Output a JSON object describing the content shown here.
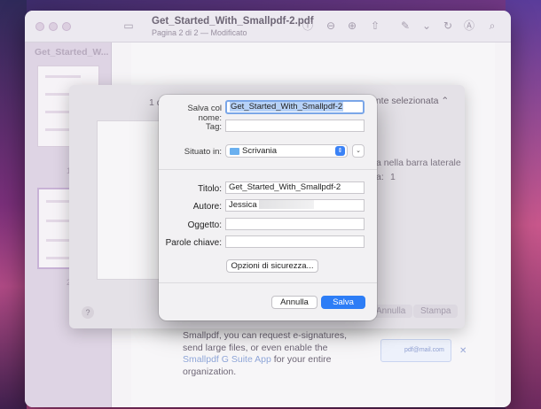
{
  "window": {
    "doc_title": "Get_Started_With_Smallpdf-2.pdf",
    "doc_subtitle": "Pagina 2 di 2 — Modificato",
    "sidebar_title": "Get_Started_W...",
    "page_number_1": "1",
    "page_number_2": "2"
  },
  "page": {
    "text_a": "Smallpdf, you can request e-signatures, send large files, or even enable the ",
    "text_link": "Smallpdf G Suite App",
    "text_b": " for your entire organization.",
    "card_email": "pdf@mail.com"
  },
  "panel": {
    "pages_prefix": "1 di",
    "select_value": "ante selezionata",
    "sidebar_text": "a nella barra laterale",
    "copies_label": "a:",
    "copies_value": "1",
    "cancel_label": "Annulla",
    "print_label": "Stampa",
    "help_label": "?"
  },
  "dialog": {
    "save_as_label": "Salva col nome:",
    "save_as_value": "Get_Started_With_Smallpdf-2",
    "tags_label": "Tag:",
    "tags_value": "",
    "where_label": "Situato in:",
    "where_value": "Scrivania",
    "title_label": "Titolo:",
    "title_value": "Get_Started_With_Smallpdf-2",
    "author_label": "Autore:",
    "author_value": "Jessica",
    "subject_label": "Oggetto:",
    "subject_value": "",
    "keywords_label": "Parole chiave:",
    "keywords_value": "",
    "security_button": "Opzioni di sicurezza...",
    "cancel_button": "Annulla",
    "save_button": "Salva"
  },
  "colors": {
    "accent": "#2d7df6",
    "focus_ring": "#7aa6e8"
  }
}
